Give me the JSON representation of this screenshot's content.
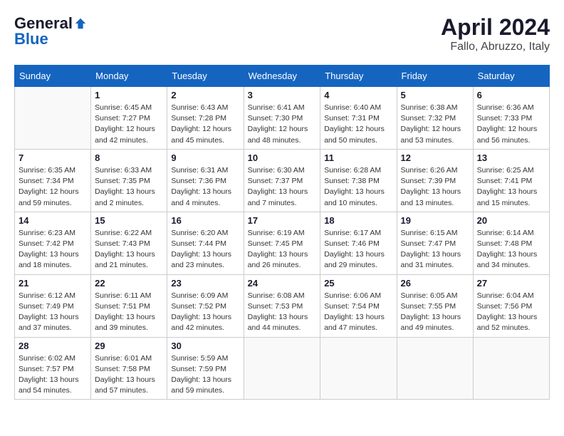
{
  "header": {
    "logo_general": "General",
    "logo_blue": "Blue",
    "month_title": "April 2024",
    "location": "Fallo, Abruzzo, Italy"
  },
  "days_of_week": [
    "Sunday",
    "Monday",
    "Tuesday",
    "Wednesday",
    "Thursday",
    "Friday",
    "Saturday"
  ],
  "weeks": [
    [
      {
        "day": "",
        "info": ""
      },
      {
        "day": "1",
        "info": "Sunrise: 6:45 AM\nSunset: 7:27 PM\nDaylight: 12 hours\nand 42 minutes."
      },
      {
        "day": "2",
        "info": "Sunrise: 6:43 AM\nSunset: 7:28 PM\nDaylight: 12 hours\nand 45 minutes."
      },
      {
        "day": "3",
        "info": "Sunrise: 6:41 AM\nSunset: 7:30 PM\nDaylight: 12 hours\nand 48 minutes."
      },
      {
        "day": "4",
        "info": "Sunrise: 6:40 AM\nSunset: 7:31 PM\nDaylight: 12 hours\nand 50 minutes."
      },
      {
        "day": "5",
        "info": "Sunrise: 6:38 AM\nSunset: 7:32 PM\nDaylight: 12 hours\nand 53 minutes."
      },
      {
        "day": "6",
        "info": "Sunrise: 6:36 AM\nSunset: 7:33 PM\nDaylight: 12 hours\nand 56 minutes."
      }
    ],
    [
      {
        "day": "7",
        "info": "Sunrise: 6:35 AM\nSunset: 7:34 PM\nDaylight: 12 hours\nand 59 minutes."
      },
      {
        "day": "8",
        "info": "Sunrise: 6:33 AM\nSunset: 7:35 PM\nDaylight: 13 hours\nand 2 minutes."
      },
      {
        "day": "9",
        "info": "Sunrise: 6:31 AM\nSunset: 7:36 PM\nDaylight: 13 hours\nand 4 minutes."
      },
      {
        "day": "10",
        "info": "Sunrise: 6:30 AM\nSunset: 7:37 PM\nDaylight: 13 hours\nand 7 minutes."
      },
      {
        "day": "11",
        "info": "Sunrise: 6:28 AM\nSunset: 7:38 PM\nDaylight: 13 hours\nand 10 minutes."
      },
      {
        "day": "12",
        "info": "Sunrise: 6:26 AM\nSunset: 7:39 PM\nDaylight: 13 hours\nand 13 minutes."
      },
      {
        "day": "13",
        "info": "Sunrise: 6:25 AM\nSunset: 7:41 PM\nDaylight: 13 hours\nand 15 minutes."
      }
    ],
    [
      {
        "day": "14",
        "info": "Sunrise: 6:23 AM\nSunset: 7:42 PM\nDaylight: 13 hours\nand 18 minutes."
      },
      {
        "day": "15",
        "info": "Sunrise: 6:22 AM\nSunset: 7:43 PM\nDaylight: 13 hours\nand 21 minutes."
      },
      {
        "day": "16",
        "info": "Sunrise: 6:20 AM\nSunset: 7:44 PM\nDaylight: 13 hours\nand 23 minutes."
      },
      {
        "day": "17",
        "info": "Sunrise: 6:19 AM\nSunset: 7:45 PM\nDaylight: 13 hours\nand 26 minutes."
      },
      {
        "day": "18",
        "info": "Sunrise: 6:17 AM\nSunset: 7:46 PM\nDaylight: 13 hours\nand 29 minutes."
      },
      {
        "day": "19",
        "info": "Sunrise: 6:15 AM\nSunset: 7:47 PM\nDaylight: 13 hours\nand 31 minutes."
      },
      {
        "day": "20",
        "info": "Sunrise: 6:14 AM\nSunset: 7:48 PM\nDaylight: 13 hours\nand 34 minutes."
      }
    ],
    [
      {
        "day": "21",
        "info": "Sunrise: 6:12 AM\nSunset: 7:49 PM\nDaylight: 13 hours\nand 37 minutes."
      },
      {
        "day": "22",
        "info": "Sunrise: 6:11 AM\nSunset: 7:51 PM\nDaylight: 13 hours\nand 39 minutes."
      },
      {
        "day": "23",
        "info": "Sunrise: 6:09 AM\nSunset: 7:52 PM\nDaylight: 13 hours\nand 42 minutes."
      },
      {
        "day": "24",
        "info": "Sunrise: 6:08 AM\nSunset: 7:53 PM\nDaylight: 13 hours\nand 44 minutes."
      },
      {
        "day": "25",
        "info": "Sunrise: 6:06 AM\nSunset: 7:54 PM\nDaylight: 13 hours\nand 47 minutes."
      },
      {
        "day": "26",
        "info": "Sunrise: 6:05 AM\nSunset: 7:55 PM\nDaylight: 13 hours\nand 49 minutes."
      },
      {
        "day": "27",
        "info": "Sunrise: 6:04 AM\nSunset: 7:56 PM\nDaylight: 13 hours\nand 52 minutes."
      }
    ],
    [
      {
        "day": "28",
        "info": "Sunrise: 6:02 AM\nSunset: 7:57 PM\nDaylight: 13 hours\nand 54 minutes."
      },
      {
        "day": "29",
        "info": "Sunrise: 6:01 AM\nSunset: 7:58 PM\nDaylight: 13 hours\nand 57 minutes."
      },
      {
        "day": "30",
        "info": "Sunrise: 5:59 AM\nSunset: 7:59 PM\nDaylight: 13 hours\nand 59 minutes."
      },
      {
        "day": "",
        "info": ""
      },
      {
        "day": "",
        "info": ""
      },
      {
        "day": "",
        "info": ""
      },
      {
        "day": "",
        "info": ""
      }
    ]
  ]
}
